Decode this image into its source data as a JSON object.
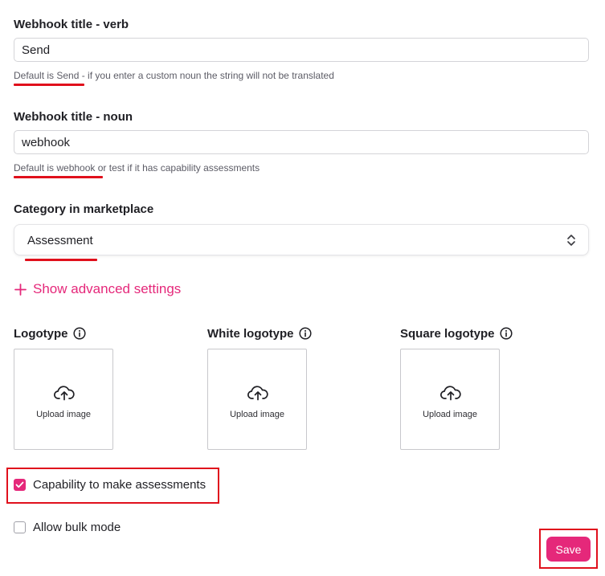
{
  "verb": {
    "label": "Webhook title - verb",
    "value": "Send",
    "hint_highlight": "Default is Send",
    "hint_rest": " - if you enter a custom noun the string will not be translated"
  },
  "noun": {
    "label": "Webhook title - noun",
    "value": "webhook",
    "hint_highlight": "Default is webhook",
    "hint_rest": " or test if it has capability assessments"
  },
  "category": {
    "label": "Category in marketplace",
    "selected": "Assessment"
  },
  "advanced": {
    "label": "Show advanced settings"
  },
  "logos": [
    {
      "label": "Logotype",
      "upload_text": "Upload image",
      "icon": "info-icon"
    },
    {
      "label": "White logotype",
      "upload_text": "Upload image",
      "icon": "info-icon"
    },
    {
      "label": "Square logotype",
      "upload_text": "Upload image",
      "icon": "info-icon"
    }
  ],
  "options": {
    "capability": {
      "label": "Capability to make assessments",
      "checked": true
    },
    "bulk": {
      "label": "Allow bulk mode",
      "checked": false
    }
  },
  "actions": {
    "save_label": "Save"
  },
  "colors": {
    "accent": "#e5287a",
    "highlight_red": "#e0101c"
  }
}
